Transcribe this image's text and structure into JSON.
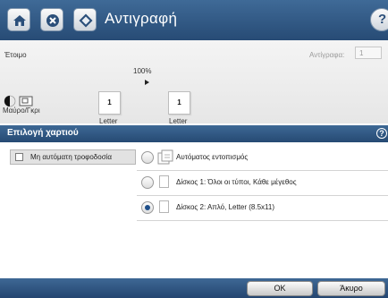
{
  "header": {
    "title": "Αντιγραφή",
    "buttons": [
      {
        "name": "home",
        "icon": "home-icon"
      },
      {
        "name": "stop",
        "icon": "stop-icon"
      },
      {
        "name": "start",
        "icon": "start-icon"
      },
      {
        "name": "help",
        "icon": "help-icon"
      }
    ]
  },
  "status": {
    "text": "Έτοιμο",
    "copies_label": "Αντίγραφα:",
    "copies_value": "1",
    "zoom": "100%",
    "original_count": "1",
    "output_count": "1",
    "original_label": "Letter",
    "output_label": "Letter",
    "color_mode_label": "Μαύρο/Γκρι"
  },
  "panel": {
    "title": "Επιλογή χαρτιού",
    "manual_feed_label": "Μη αυτόματη τροφοδοσία",
    "manual_feed_checked": false,
    "options": [
      {
        "label": "Αυτόματος εντοπισμός",
        "selected": false,
        "icon": "auto-detect-icon"
      },
      {
        "label": "Δίσκος 1: Όλοι οι τύποι, Κάθε μέγεθος",
        "selected": false,
        "icon": "paper-icon"
      },
      {
        "label": "Δίσκος 2: Απλό, Letter (8.5x11)",
        "selected": true,
        "icon": "paper-icon"
      }
    ]
  },
  "footer": {
    "ok_label": "OK",
    "cancel_label": "Άκυρο"
  },
  "colors": {
    "header_blue": "#2f5885",
    "selected_radio": "#1f4f8a"
  }
}
